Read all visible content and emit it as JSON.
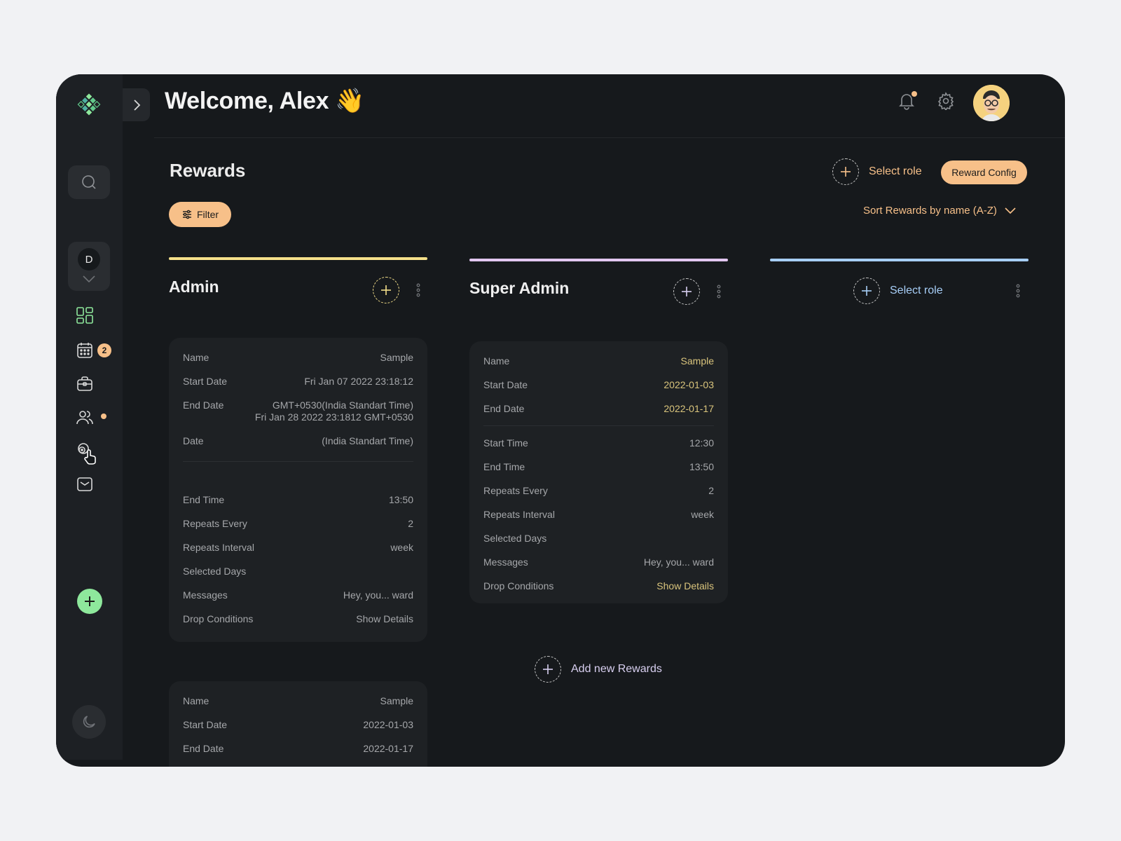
{
  "header": {
    "welcome": "Welcome, Alex 👋"
  },
  "sidebar": {
    "workspace_initial": "D",
    "calendar_badge": "2",
    "icons": [
      "logo-icon",
      "chevron-right-icon",
      "search-icon",
      "dashboard-icon",
      "calendar-icon",
      "briefcase-icon",
      "users-icon",
      "rewards-icon",
      "mail-icon",
      "plus-icon",
      "moon-icon"
    ]
  },
  "page": {
    "title": "Rewards",
    "filter_label": "Filter",
    "select_role_label": "Select role",
    "reward_config_label": "Reward Config",
    "sort_label": "Sort Rewards by name (A-Z)",
    "add_new_label": "Add new Rewards"
  },
  "columns": [
    {
      "title": "Admin",
      "color": "#f5e08a",
      "cards": [
        {
          "rows": [
            {
              "k": "Name",
              "v": "Sample"
            },
            {
              "k": "Start Date",
              "v": "Fri Jan 07 2022 23:18:12"
            },
            {
              "k": "End Date",
              "v": "GMT+0530(India Standart Time)\nFri Jan 28 2022 23:1812 GMT+0530"
            },
            {
              "k": "Date",
              "v": "(India Standart Time)"
            },
            {
              "k": "End Time",
              "v": "13:50"
            },
            {
              "k": "Repeats Every",
              "v": "2"
            },
            {
              "k": "Repeats Interval",
              "v": "week"
            },
            {
              "k": "Selected Days",
              "v": ""
            },
            {
              "k": "Messages",
              "v": "Hey, you... ward"
            },
            {
              "k": "Drop Conditions",
              "v": "Show Details"
            }
          ]
        },
        {
          "rows": [
            {
              "k": "Name",
              "v": "Sample"
            },
            {
              "k": "Start Date",
              "v": "2022-01-03"
            },
            {
              "k": "End Date",
              "v": "2022-01-17"
            }
          ]
        }
      ]
    },
    {
      "title": "Super Admin",
      "color": "#e2c6f0",
      "cards": [
        {
          "rows": [
            {
              "k": "Name",
              "v": "Sample"
            },
            {
              "k": "Start Date",
              "v": "2022-01-03"
            },
            {
              "k": "End Date",
              "v": "2022-01-17"
            },
            {
              "k": "Start Time",
              "v": "12:30"
            },
            {
              "k": "End Time",
              "v": "13:50"
            },
            {
              "k": "Repeats Every",
              "v": "2"
            },
            {
              "k": "Repeats Interval",
              "v": "week"
            },
            {
              "k": "Selected Days",
              "v": ""
            },
            {
              "k": "Messages",
              "v": "Hey, you... ward"
            },
            {
              "k": "Drop Conditions",
              "v": "Show Details"
            }
          ]
        }
      ]
    },
    {
      "title": "Select role",
      "color": "#a7cef7",
      "cards": []
    }
  ],
  "colors": {
    "accent": "#f7c089",
    "green": "#8ee89c",
    "bg": "#16191c",
    "card": "#1e2124"
  }
}
